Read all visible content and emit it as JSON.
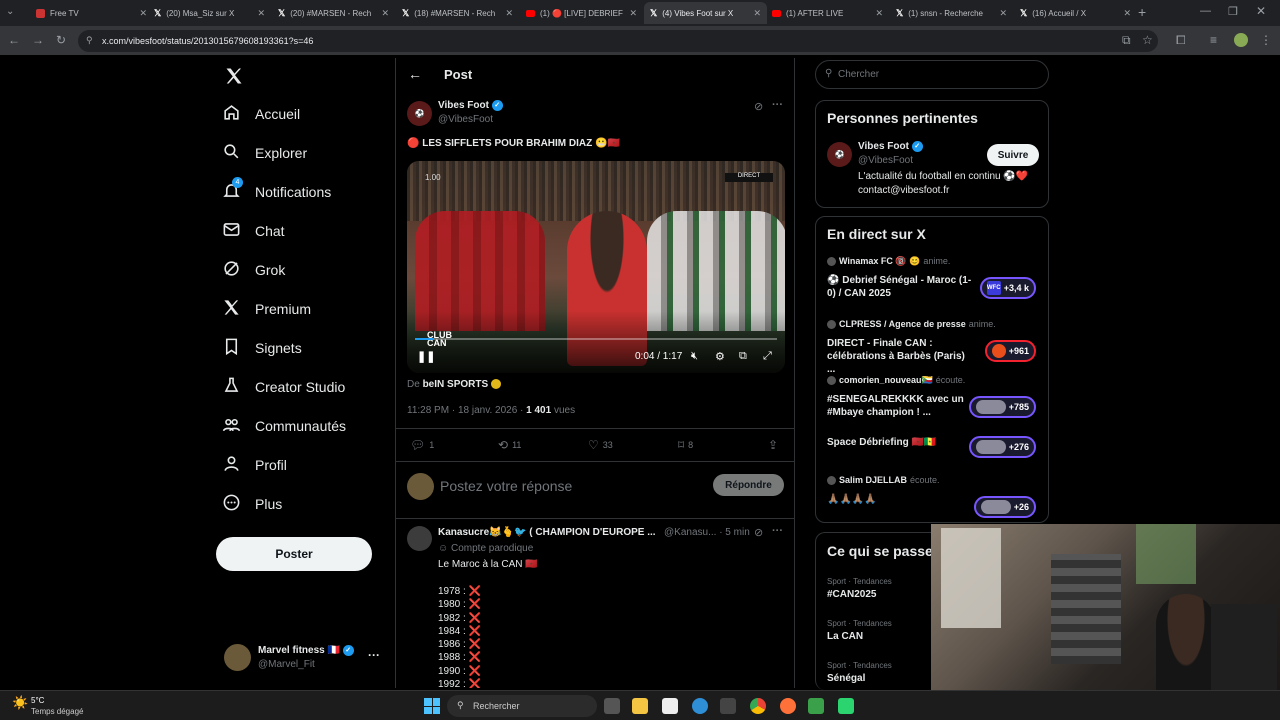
{
  "browser": {
    "tabs": [
      {
        "label": "Free TV",
        "icon": "tv-icon"
      },
      {
        "label": "(20) Msa_Siz sur X",
        "icon": "x-icon"
      },
      {
        "label": "(20) #MARSEN - Rech",
        "icon": "x-icon"
      },
      {
        "label": "(18) #MARSEN - Rech",
        "icon": "x-icon"
      },
      {
        "label": "(1) 🔴 [LIVE] DEBRIEF",
        "icon": "youtube-icon"
      },
      {
        "label": "(4) Vibes Foot sur X",
        "icon": "x-icon"
      },
      {
        "label": "(1) AFTER LIVE",
        "icon": "youtube-icon"
      },
      {
        "label": "(1) snsn - Recherche",
        "icon": "x-icon"
      },
      {
        "label": "(16) Accueil / X",
        "icon": "x-icon"
      }
    ],
    "active_tab": 5,
    "url": "x.com/vibesfoot/status/2013015679608193361?s=46"
  },
  "leftnav": {
    "items": [
      {
        "label": "Accueil",
        "icon": "home-icon"
      },
      {
        "label": "Explorer",
        "icon": "search-icon"
      },
      {
        "label": "Notifications",
        "icon": "bell-icon",
        "badge": "4"
      },
      {
        "label": "Chat",
        "icon": "mail-icon"
      },
      {
        "label": "Grok",
        "icon": "grok-icon"
      },
      {
        "label": "Premium",
        "icon": "x-logo-icon"
      },
      {
        "label": "Signets",
        "icon": "bookmark-icon"
      },
      {
        "label": "Creator Studio",
        "icon": "flask-icon"
      },
      {
        "label": "Communautés",
        "icon": "people-icon"
      },
      {
        "label": "Profil",
        "icon": "person-icon"
      },
      {
        "label": "Plus",
        "icon": "more-circle-icon"
      }
    ],
    "post_button": "Poster",
    "account": {
      "name": "Marvel fitness 🇫🇷",
      "handle": "@Marvel_Fit"
    }
  },
  "post": {
    "header_title": "Post",
    "author_name": "Vibes Foot",
    "author_handle": "@VibesFoot",
    "text": "🔴 LES SIFFLETS POUR BRAHIM DIAZ 😬🇲🇦",
    "video": {
      "time": "0:04 / 1:17",
      "overlay_tag": "CLUB CAN",
      "progress": 0.052,
      "top_left": "1.00"
    },
    "source_prefix": "De",
    "source_name": "beIN SPORTS",
    "timestamp": "11:28 PM · 18 janv. 2026 ·",
    "views_count": "1 401",
    "views_label": "vues",
    "stats": {
      "replies": "1",
      "reposts": "11",
      "likes": "33",
      "bookmarks": "8"
    },
    "reply_placeholder": "Postez votre réponse",
    "reply_button": "Répondre"
  },
  "reply": {
    "author_name": "Kanasucre😹🫰🐦 ( CHAMPION D'EUROPE ...",
    "author_handle": "@Kanasu...",
    "time": "· 5 min",
    "parody_label": "Compte parodique",
    "text": "Le Maroc à la CAN 🇲🇦",
    "years": [
      "1978 : ❌",
      "1980 : ❌",
      "1982 : ❌",
      "1984 : ❌",
      "1986 : ❌",
      "1988 : ❌",
      "1990 : ❌",
      "1992 : ❌"
    ]
  },
  "right": {
    "search_placeholder": "Chercher",
    "relevant": {
      "title": "Personnes pertinentes",
      "name": "Vibes Foot",
      "handle": "@VibesFoot",
      "follow": "Suivre",
      "bio_line1": "L'actualité du football en continu ⚽❤️",
      "bio_line2": "contact@vibesfoot.fr"
    },
    "live": {
      "title": "En direct sur X",
      "items": [
        {
          "host": "Winamax FC 🔞 😊",
          "role": "anime.",
          "title": "⚽ Debrief Sénégal - Maroc (1-0) / CAN 2025",
          "count": "+3,4 k",
          "pill": "WFC"
        },
        {
          "host": "CLPRESS / Agence de presse",
          "role": "anime.",
          "title": "DIRECT - Finale CAN : célébrations à Barbès (Paris) ...",
          "count": "+961",
          "pill": ""
        },
        {
          "host": "comorien_nouveau🇰🇲",
          "role": "écoute.",
          "title": "#SENEGALREKKKK avec un #Mbaye champion ! ...",
          "count": "+785",
          "pill": ""
        },
        {
          "host": "",
          "role": "",
          "title": "Space Débriefing 🇲🇦🇸🇳",
          "count": "+276",
          "pill": ""
        },
        {
          "host": "Salim DJELLAB",
          "role": "écoute.",
          "title": "🙏🏽🙏🏽🙏🏽🙏🏽",
          "count": "+26",
          "pill": ""
        }
      ]
    },
    "trending": {
      "title": "Ce qui se passe",
      "items": [
        {
          "category": "Sport · Tendances",
          "name": "#CAN2025"
        },
        {
          "category": "Sport · Tendances",
          "name": "La CAN"
        },
        {
          "category": "Sport · Tendances",
          "name": "Sénégal"
        }
      ]
    }
  },
  "taskbar": {
    "weather_temp": "5°C",
    "weather_desc": "Temps dégagé",
    "search_label": "Rechercher"
  },
  "colors": {
    "accent": "#1d9bf0",
    "background": "#000000",
    "border": "#2f3336",
    "muted": "#71767b"
  }
}
